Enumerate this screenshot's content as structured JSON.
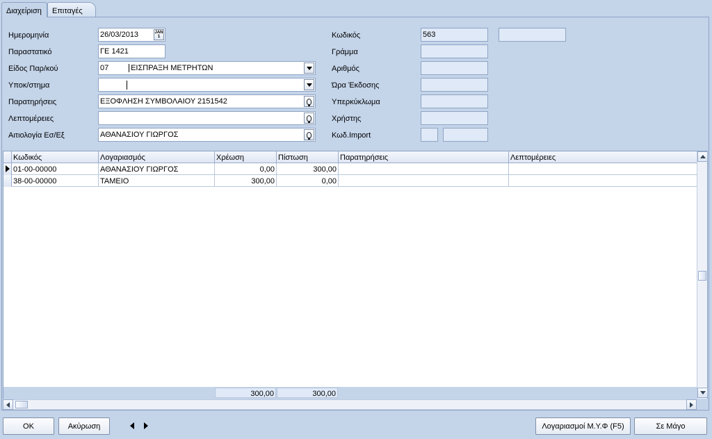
{
  "tabs": [
    {
      "label": "Διαχείριση",
      "active": true
    },
    {
      "label": "Επιταγές",
      "active": false
    }
  ],
  "form": {
    "date": {
      "label": "Ημερομηνία",
      "value": "26/03/2013"
    },
    "document": {
      "label": "Παραστατικό",
      "value": "ΓΕ 1421"
    },
    "doc_type": {
      "label": "Είδος Παρ/κού",
      "code": "07",
      "value": "ΕΙΣΠΡΑΞΗ ΜΕΤΡΗΤΩΝ"
    },
    "branch": {
      "label": "Υποκ/στημα",
      "code": "",
      "value": ""
    },
    "remarks": {
      "label": "Παρατηρήσεις",
      "value": "ΕΞΟΦΛΗΣΗ ΣΥΜΒΟΛΑΙΟΥ 2151542"
    },
    "details": {
      "label": "Λεπτομέρειες",
      "value": ""
    },
    "justification": {
      "label": "Αιτιολογία Εσ/Εξ",
      "value": "ΑΘΑΝΑΣΙΟΥ ΓΙΩΡΓΟΣ"
    },
    "code": {
      "label": "Κωδικός",
      "value": "563",
      "extra": ""
    },
    "letter": {
      "label": "Γράμμα",
      "value": ""
    },
    "number": {
      "label": "Αριθμός",
      "value": ""
    },
    "issue_time": {
      "label": "Ώρα Έκδοσης",
      "value": ""
    },
    "supercycle": {
      "label": "Υπερκύκλωμα",
      "value": ""
    },
    "user": {
      "label": "Χρήστης",
      "value": ""
    },
    "import_code": {
      "label": "Κωδ.Import",
      "value": "",
      "value2": ""
    }
  },
  "grid": {
    "columns": [
      "Κωδικός",
      "Λογαριασμός",
      "Χρέωση",
      "Πίστωση",
      "Παρατηρήσεις",
      "Λεπτομέρειες"
    ],
    "rows": [
      {
        "code": "01-00-00000",
        "account": "ΑΘΑΝΑΣΙΟΥ ΓΙΩΡΓΟΣ",
        "debit": "0,00",
        "credit": "300,00",
        "remarks": "",
        "details": ""
      },
      {
        "code": "38-00-00000",
        "account": "ΤΑΜΕΙΟ",
        "debit": "300,00",
        "credit": "0,00",
        "remarks": "",
        "details": ""
      }
    ],
    "totals": {
      "debit": "300,00",
      "credit": "300,00"
    }
  },
  "buttons": {
    "ok": "ΟΚ",
    "cancel": "Ακύρωση",
    "accounts": "Λογαριασμοί Μ.Υ.Φ (F5)",
    "magic": "Σε Μάγο"
  },
  "icons": {
    "calendar": "calendar-icon",
    "dropdown": "chevron-down-icon",
    "lookup": "lightbulb-icon"
  }
}
